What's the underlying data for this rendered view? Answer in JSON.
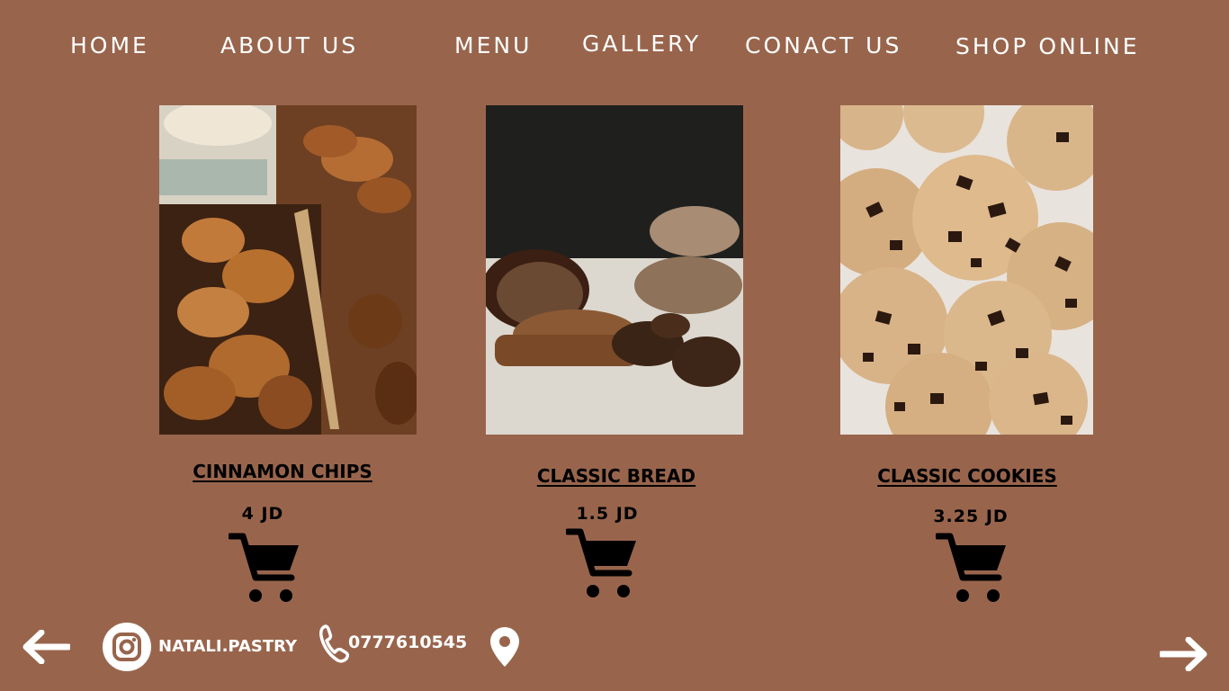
{
  "nav": {
    "home": "HOME",
    "about": "ABOUT US",
    "menu": "MENU",
    "gallery": "GALLERY",
    "contact": "CONACT US",
    "shop": "SHOP ONLINE"
  },
  "products": [
    {
      "name": "CINNAMON CHIPS",
      "price": "4 JD",
      "image": "cinnamon-chips-photo"
    },
    {
      "name": "CLASSIC BREAD",
      "price": "1.5 JD",
      "image": "classic-bread-photo"
    },
    {
      "name": "CLASSIC COOKIES",
      "price": "3.25 JD",
      "image": "classic-cookies-photo"
    }
  ],
  "footer": {
    "instagram_handle": "NATALI.PASTRY",
    "phone": "0777610545",
    "icons": [
      "arrow-left-icon",
      "instagram-icon",
      "phone-icon",
      "location-pin-icon",
      "arrow-right-icon"
    ]
  },
  "colors": {
    "background": "#98654c",
    "text_light": "#ffffff",
    "text_dark": "#000000"
  }
}
